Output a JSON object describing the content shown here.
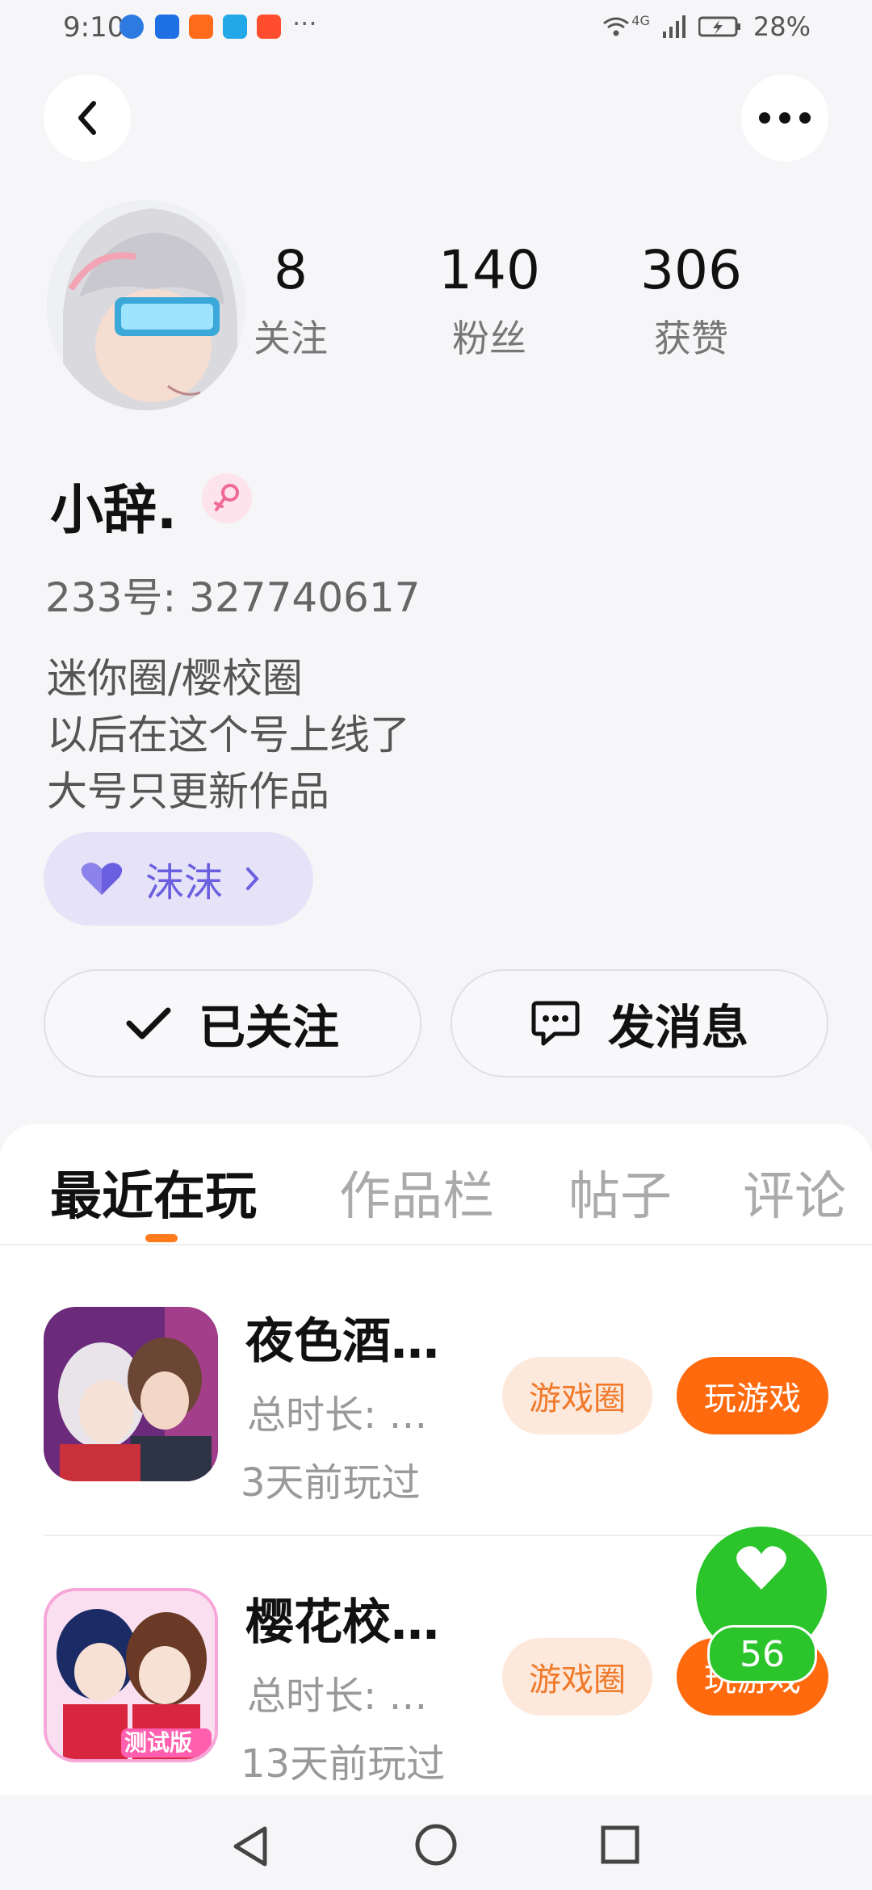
{
  "status": {
    "time": "9:10",
    "battery": "28%",
    "more": "···",
    "network": "4G"
  },
  "profile": {
    "name": "小辞.",
    "account_id": "233号: 327740617",
    "bio": [
      "迷你圈/樱校圈",
      "以后在这个号上线了",
      "大号只更新作品"
    ],
    "stats": [
      {
        "value": "8",
        "label": "关注"
      },
      {
        "value": "140",
        "label": "粉丝"
      },
      {
        "value": "306",
        "label": "获赞"
      }
    ],
    "circle_tag": "沫沫"
  },
  "actions": {
    "follow": "已关注",
    "message": "发消息"
  },
  "tabs": [
    "最近在玩",
    "作品栏",
    "帖子",
    "评论"
  ],
  "games": [
    {
      "title": "夜色酒…",
      "duration": "总时长: …",
      "last_played": "3天前玩过",
      "circle_button": "游戏圈",
      "play_button": "玩游戏"
    },
    {
      "title": "樱花校…",
      "duration": "总时长: …",
      "last_played": "13天前玩过",
      "circle_button": "游戏圈",
      "play_button": "玩游戏",
      "icon_badge": "测试版"
    }
  ],
  "float_like": {
    "count": "56"
  },
  "colors": {
    "accent": "#ff6a0f",
    "like_green": "#2bc52b",
    "circle_purple": "#6a5fe0"
  }
}
